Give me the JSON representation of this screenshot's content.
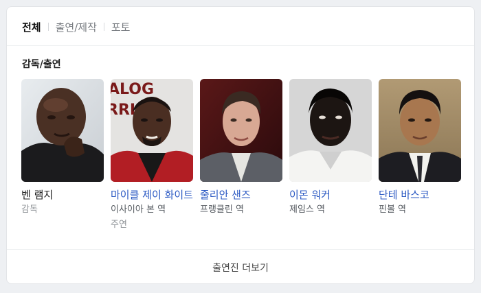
{
  "tabs": [
    {
      "label": "전체",
      "active": true
    },
    {
      "label": "출연/제작",
      "active": false
    },
    {
      "label": "포토",
      "active": false
    }
  ],
  "section": {
    "title": "감독/출연"
  },
  "people": [
    {
      "name": "벤 램지",
      "role": "감독",
      "sub_role": "",
      "linked": false
    },
    {
      "name": "마이클 제이 화이트",
      "role": "이사이아 본 역",
      "sub_role": "주연",
      "linked": true
    },
    {
      "name": "줄리안 샌즈",
      "role": "프랭클린 역",
      "sub_role": "",
      "linked": true
    },
    {
      "name": "이몬 워커",
      "role": "제임스 역",
      "sub_role": "",
      "linked": true
    },
    {
      "name": "단테 바스코",
      "role": "핀볼 역",
      "sub_role": "",
      "linked": true
    }
  ],
  "more_button": {
    "label": "출연진 더보기"
  },
  "colors": {
    "link": "#2b59c3",
    "text": "#222222",
    "muted": "#909498",
    "background": "#eef0f3"
  }
}
